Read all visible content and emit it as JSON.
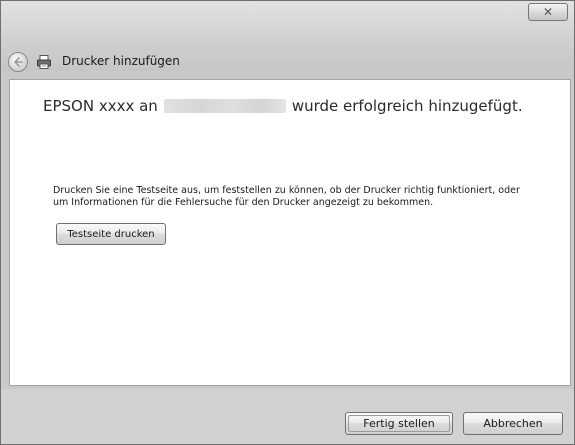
{
  "window": {
    "title": "Drucker hinzufügen",
    "close_label": "✕"
  },
  "main": {
    "heading_prefix": "EPSON xxxx an",
    "heading_suffix": "wurde erfolgreich hinzugefügt.",
    "description_line1": "Drucken Sie eine Testseite aus, um feststellen zu können, ob der Drucker richtig funktioniert, oder",
    "description_line2": "um Informationen für die Fehlersuche für den Drucker angezeigt zu bekommen.",
    "test_page_button": "Testseite drucken"
  },
  "footer": {
    "finish_button": "Fertig stellen",
    "cancel_button": "Abbrechen"
  },
  "icons": {
    "back": "back-arrow-icon",
    "printer": "printer-icon",
    "close": "close-icon"
  }
}
